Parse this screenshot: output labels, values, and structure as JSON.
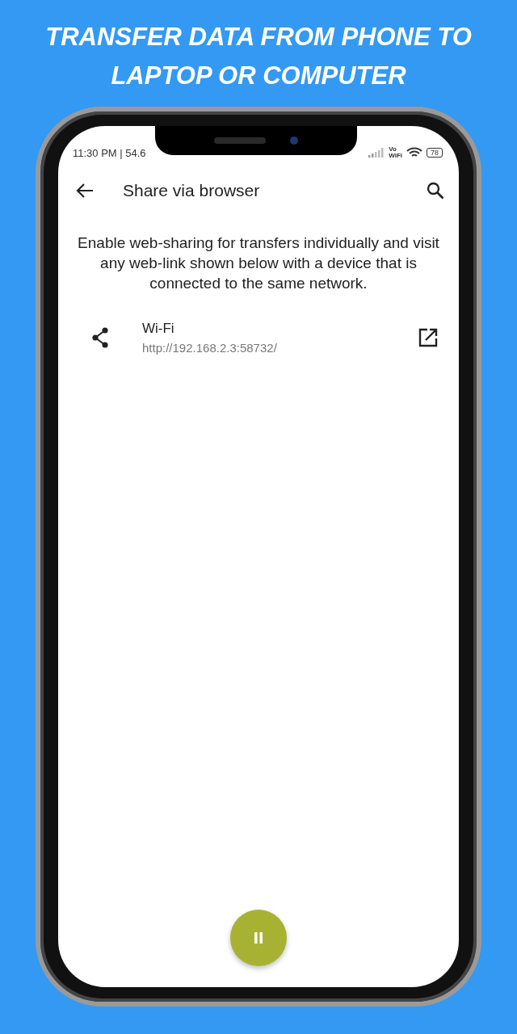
{
  "headline": [
    "TRANSFER DATA FROM PHONE TO",
    "LAPTOP OR COMPUTER"
  ],
  "status_bar": {
    "time": "11:30 PM | 54.6",
    "network_label": "Vo\nWiFi",
    "battery": "78"
  },
  "app_bar": {
    "title": "Share via browser"
  },
  "description": "Enable web-sharing for transfers individually and visit any web-link shown below with a device that is connected to the same network.",
  "links": [
    {
      "name": "Wi-Fi",
      "url": "http://192.168.2.3:58732/"
    }
  ]
}
